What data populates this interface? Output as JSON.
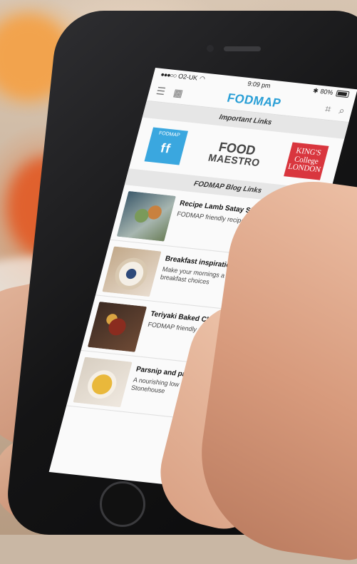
{
  "status": {
    "carrier": "O2-UK",
    "time": "9:09 pm",
    "battery": "80%"
  },
  "nav": {
    "title": "FODMAP"
  },
  "important_links": {
    "header": "Important Links",
    "logos": [
      {
        "name": "FODMAP",
        "mark": "ff"
      },
      {
        "name": "FOOD",
        "line2": "MAESTRO"
      },
      {
        "name": "KING'S",
        "line2": "College",
        "line3": "LONDON"
      }
    ]
  },
  "blog": {
    "header": "FODMAP Blog Links",
    "items": [
      {
        "title": "Recipe Lamb Satay Skewers",
        "desc": "FODMAP friendly recipe from GutRx Gurus"
      },
      {
        "title": "Breakfast inspiration for low FODM...",
        "desc": "Make your mornings a bit easier with quick breakfast choices"
      },
      {
        "title": "Teriyaki Baked Chicken",
        "desc": "FODMAP friendly recipe by Gut R... Gurus"
      },
      {
        "title": "Parsnip and parsley soup",
        "desc": "A nourishing low FODMAP rec... shared by Laura Stonehouse"
      }
    ]
  },
  "colors": {
    "accent": "#2a9fd6",
    "fodmap_logo": "#3aa7df",
    "kings_logo": "#d9363e"
  }
}
